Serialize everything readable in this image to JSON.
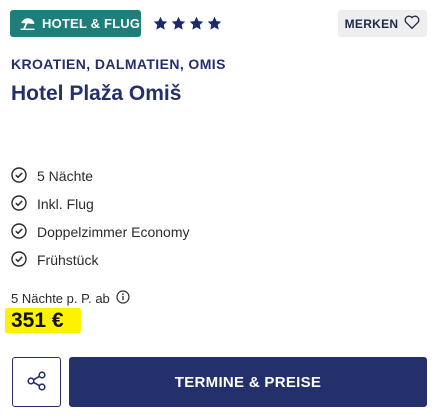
{
  "badge": {
    "icon": "beach-umbrella-icon",
    "label": "HOTEL & FLUG"
  },
  "rating": {
    "stars": 4,
    "icon": "star-icon",
    "color": "#1c2b6b"
  },
  "bookmark": {
    "label": "MERKEN",
    "icon": "heart-outline-icon"
  },
  "hotel": {
    "location": "KROATIEN, DALMATIEN, OMIS",
    "name": "Hotel Plaža Omiš"
  },
  "features": [
    {
      "icon": "check-circle-icon",
      "label": "5 Nächte"
    },
    {
      "icon": "check-circle-icon",
      "label": "Inkl. Flug"
    },
    {
      "icon": "check-circle-icon",
      "label": "Doppelzimmer Economy"
    },
    {
      "icon": "check-circle-icon",
      "label": "Frühstück"
    }
  ],
  "pricing": {
    "label": "5 Nächte p. P. ab",
    "info_icon": "info-icon",
    "price": "351 €",
    "highlight_color": "#fff200"
  },
  "actions": {
    "share_icon": "share-icon",
    "cta_label": "TERMINE & PREISE"
  },
  "colors": {
    "badge_bg": "#1e7f7a",
    "primary": "#23306b"
  }
}
